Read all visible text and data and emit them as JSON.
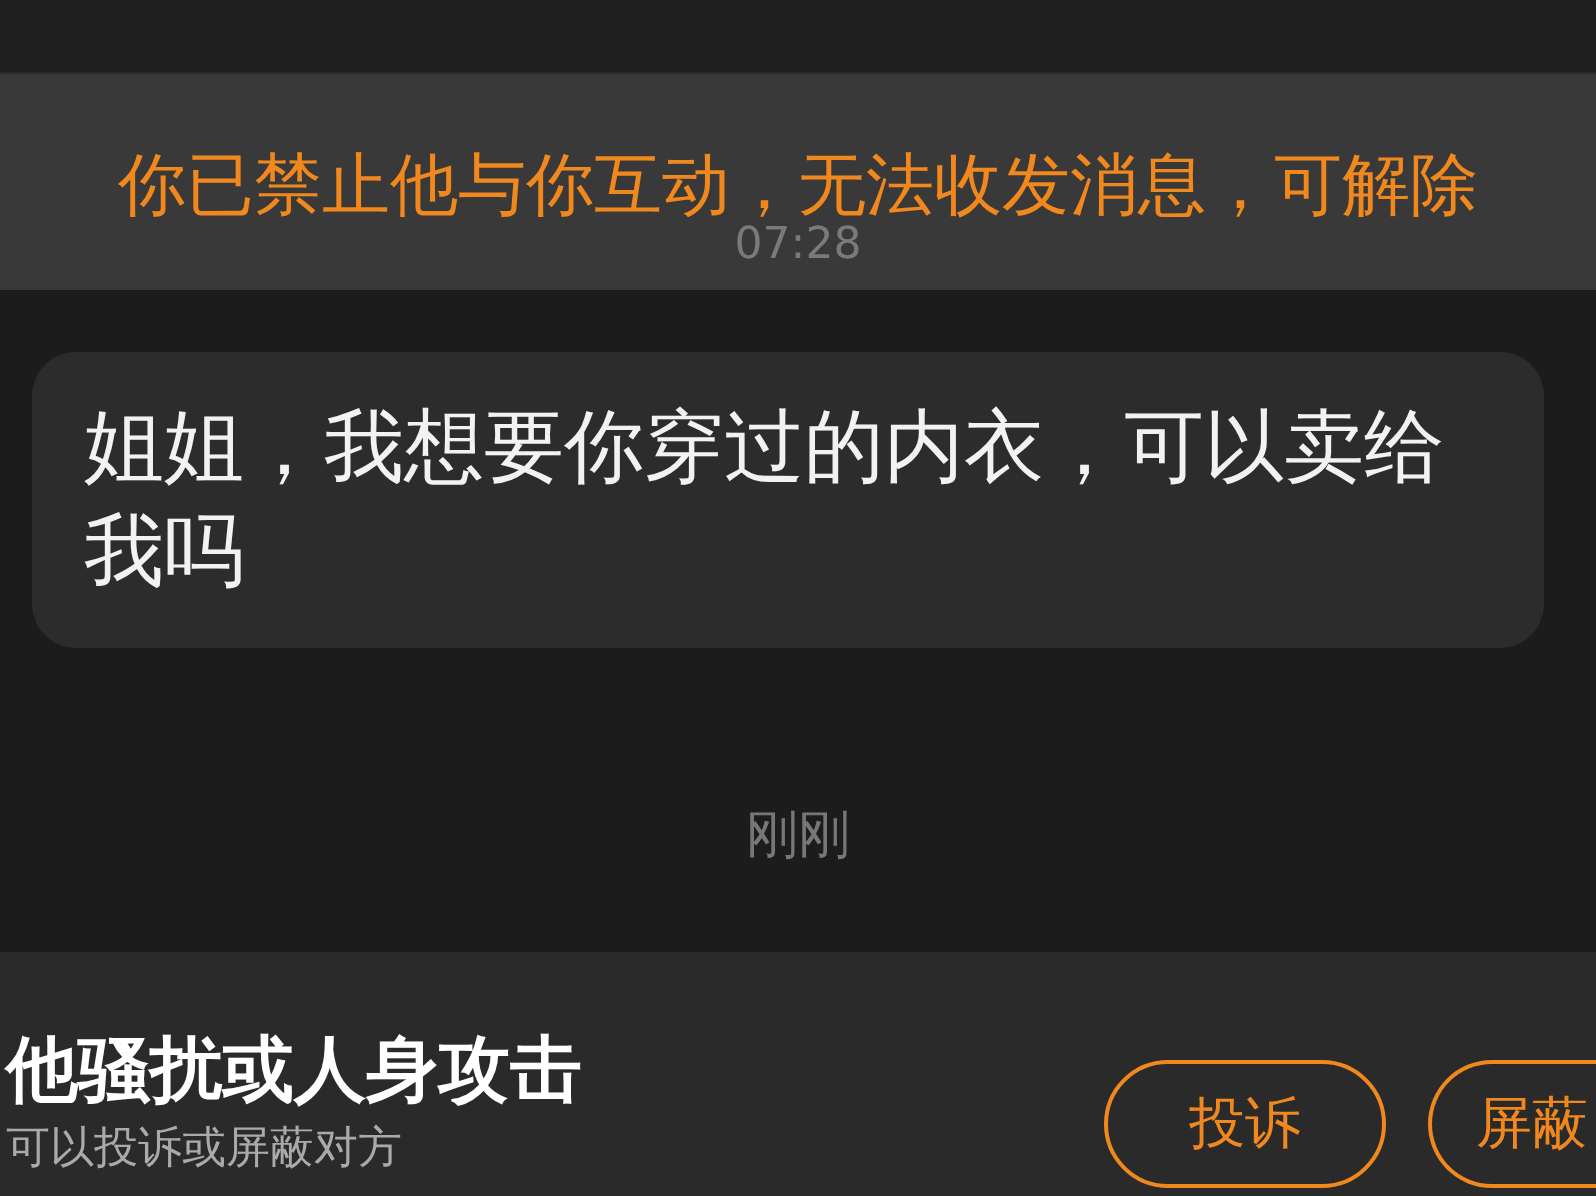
{
  "banner": {
    "text": "你已禁止他与你互动，无法收发消息，可解除",
    "timestamp": "07:28"
  },
  "messages": [
    {
      "text": "姐姐，我想要你穿过的内衣，可以卖给我吗",
      "time": "刚刚"
    }
  ],
  "report_panel": {
    "title": "他骚扰或人身攻击",
    "subtitle": "可以投诉或屏蔽对方",
    "buttons": [
      {
        "label": "投诉"
      },
      {
        "label": "屏蔽"
      }
    ]
  }
}
